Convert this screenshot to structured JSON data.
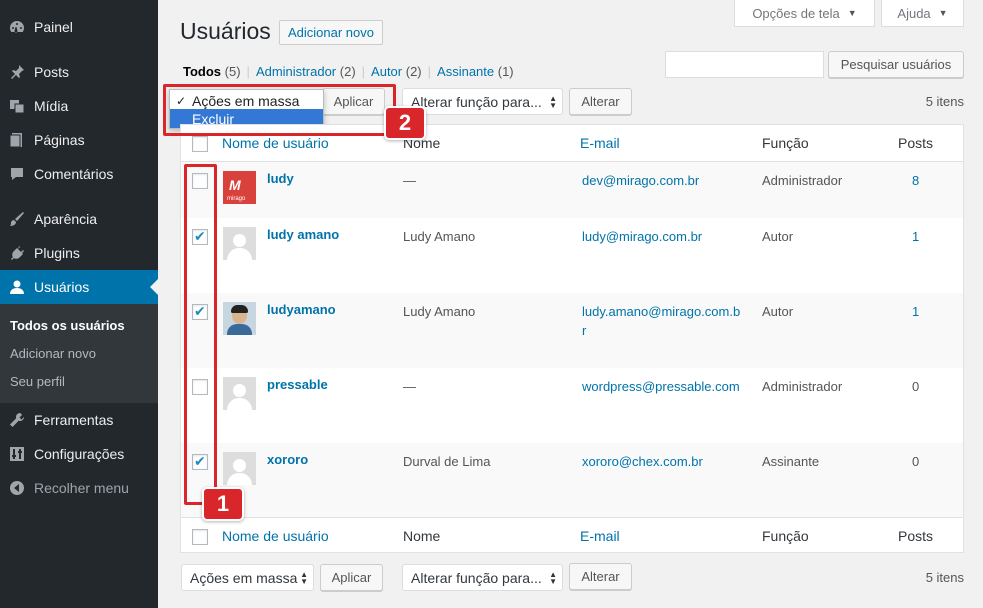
{
  "sidebar": {
    "items": [
      {
        "label": "Painel",
        "icon": "dashboard-icon"
      },
      {
        "label": "Posts",
        "icon": "pin-icon"
      },
      {
        "label": "Mídia",
        "icon": "media-icon"
      },
      {
        "label": "Páginas",
        "icon": "page-icon"
      },
      {
        "label": "Comentários",
        "icon": "comment-icon"
      },
      {
        "label": "Aparência",
        "icon": "brush-icon"
      },
      {
        "label": "Plugins",
        "icon": "plugin-icon"
      },
      {
        "label": "Usuários",
        "icon": "user-icon"
      },
      {
        "label": "Ferramentas",
        "icon": "wrench-icon"
      },
      {
        "label": "Configurações",
        "icon": "settings-icon"
      },
      {
        "label": "Recolher menu",
        "icon": "collapse-icon"
      }
    ],
    "submenu": [
      "Todos os usuários",
      "Adicionar novo",
      "Seu perfil"
    ]
  },
  "header": {
    "screen_options": "Opções de tela",
    "help": "Ajuda",
    "title": "Usuários",
    "add_new": "Adicionar novo"
  },
  "filters": {
    "all": "Todos",
    "all_count": "(5)",
    "admin": "Administrador",
    "admin_count": "(2)",
    "author": "Autor",
    "author_count": "(2)",
    "subscriber": "Assinante",
    "subscriber_count": "(1)"
  },
  "search": {
    "button": "Pesquisar usuários"
  },
  "bulk": {
    "selected": "Ações em massa",
    "options": [
      "Ações em massa",
      "Excluir"
    ],
    "apply": "Aplicar",
    "role": "Alterar função para...",
    "change": "Alterar",
    "count": "5 itens"
  },
  "table": {
    "columns": [
      "Nome de usuário",
      "Nome",
      "E-mail",
      "Função",
      "Posts"
    ],
    "rows": [
      {
        "username": "ludy",
        "name": "—",
        "email": "dev@mirago.com.br",
        "role": "Administrador",
        "posts": "8",
        "checked": false
      },
      {
        "username": "ludy amano",
        "name": "Ludy Amano",
        "email": "ludy@mirago.com.br",
        "role": "Autor",
        "posts": "1",
        "checked": true
      },
      {
        "username": "ludyamano",
        "name": "Ludy Amano",
        "email": "ludy.amano@mirago.com.br",
        "role": "Autor",
        "posts": "1",
        "checked": true
      },
      {
        "username": "pressable",
        "name": "—",
        "email": "wordpress@pressable.com",
        "role": "Administrador",
        "posts": "0",
        "checked": false
      },
      {
        "username": "xororo",
        "name": "Durval de Lima",
        "email": "xororo@chex.com.br",
        "role": "Assinante",
        "posts": "0",
        "checked": true
      }
    ]
  },
  "annotations": {
    "one": "1",
    "two": "2"
  },
  "colors": {
    "accent": "#0073aa",
    "sidebar": "#23282d",
    "annotation": "#d9262b"
  }
}
